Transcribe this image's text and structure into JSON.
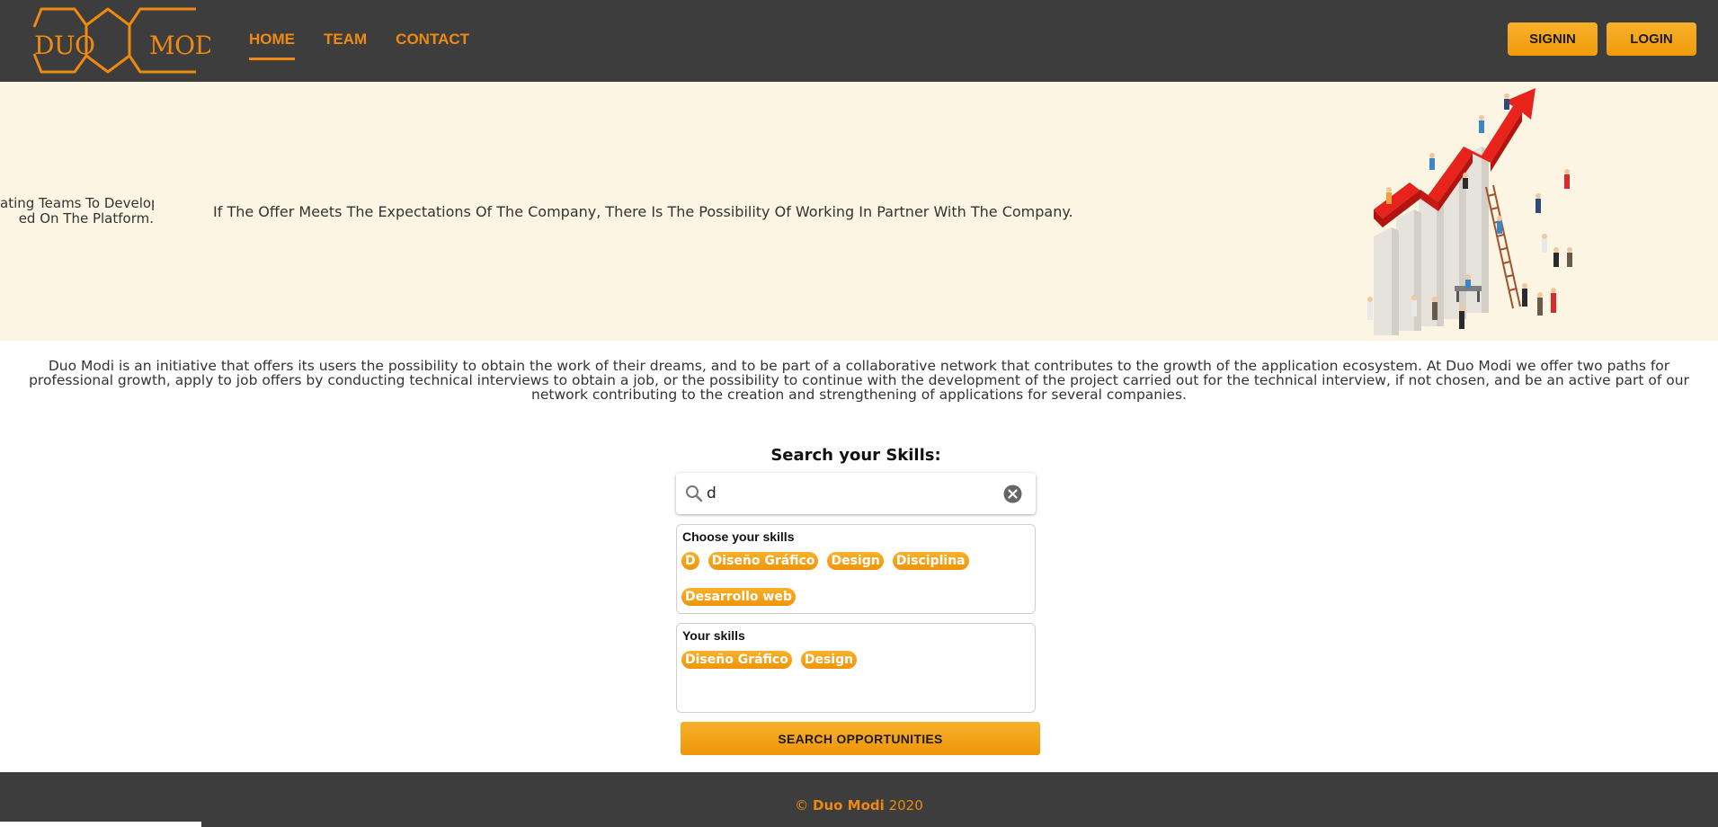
{
  "header": {
    "logo": {
      "left_text": "DUO",
      "right_text": "MODI"
    },
    "nav": [
      {
        "label": "HOME",
        "active": true
      },
      {
        "label": "TEAM",
        "active": false
      },
      {
        "label": "CONTACT",
        "active": false
      }
    ],
    "signin_label": "SIGNIN",
    "login_label": "LOGIN"
  },
  "hero": {
    "prev_slide_line1": "ating Teams To Develop",
    "prev_slide_line2": "ed On The Platform.",
    "text": "If The Offer Meets The Expectations Of The Company, There Is The Possibility Of Working In Partner With The Company.",
    "illustration_icon": "growth-arrow-people-illustration"
  },
  "description": "Duo Modi is an initiative that offers its users the possibility to obtain the work of their dreams, and to be part of a collaborative network that contributes to the growth of the application ecosystem. At Duo Modi we offer two paths for professional growth, apply to job offers by conducting technical interviews to obtain a job, or the possibility to continue with the development of the project carried out for the technical interview, if not chosen, and be an active part of our network contributing to the creation and strengthening of applications for several companies.",
  "search": {
    "title": "Search your Skills:",
    "value": "d",
    "icon": "search-icon",
    "clear_icon": "clear-circle-icon"
  },
  "choose_skills": {
    "title": "Choose your skills",
    "chips": [
      "D",
      "Diseño Gráfico",
      "Design",
      "Disciplina",
      "Desarrollo web"
    ]
  },
  "your_skills": {
    "title": "Your skills",
    "chips": [
      "Diseño Gráfico",
      "Design"
    ]
  },
  "search_button_label": "SEARCH OPPORTUNITIES",
  "footer": {
    "copyright_symbol": "©",
    "brand": "Duo Modi",
    "year": "2020"
  },
  "colors": {
    "header_bg": "#3d3d3d",
    "accent": "#ee8a12",
    "button": "#f5a71c",
    "hero_bg": "#fdf5e4"
  }
}
